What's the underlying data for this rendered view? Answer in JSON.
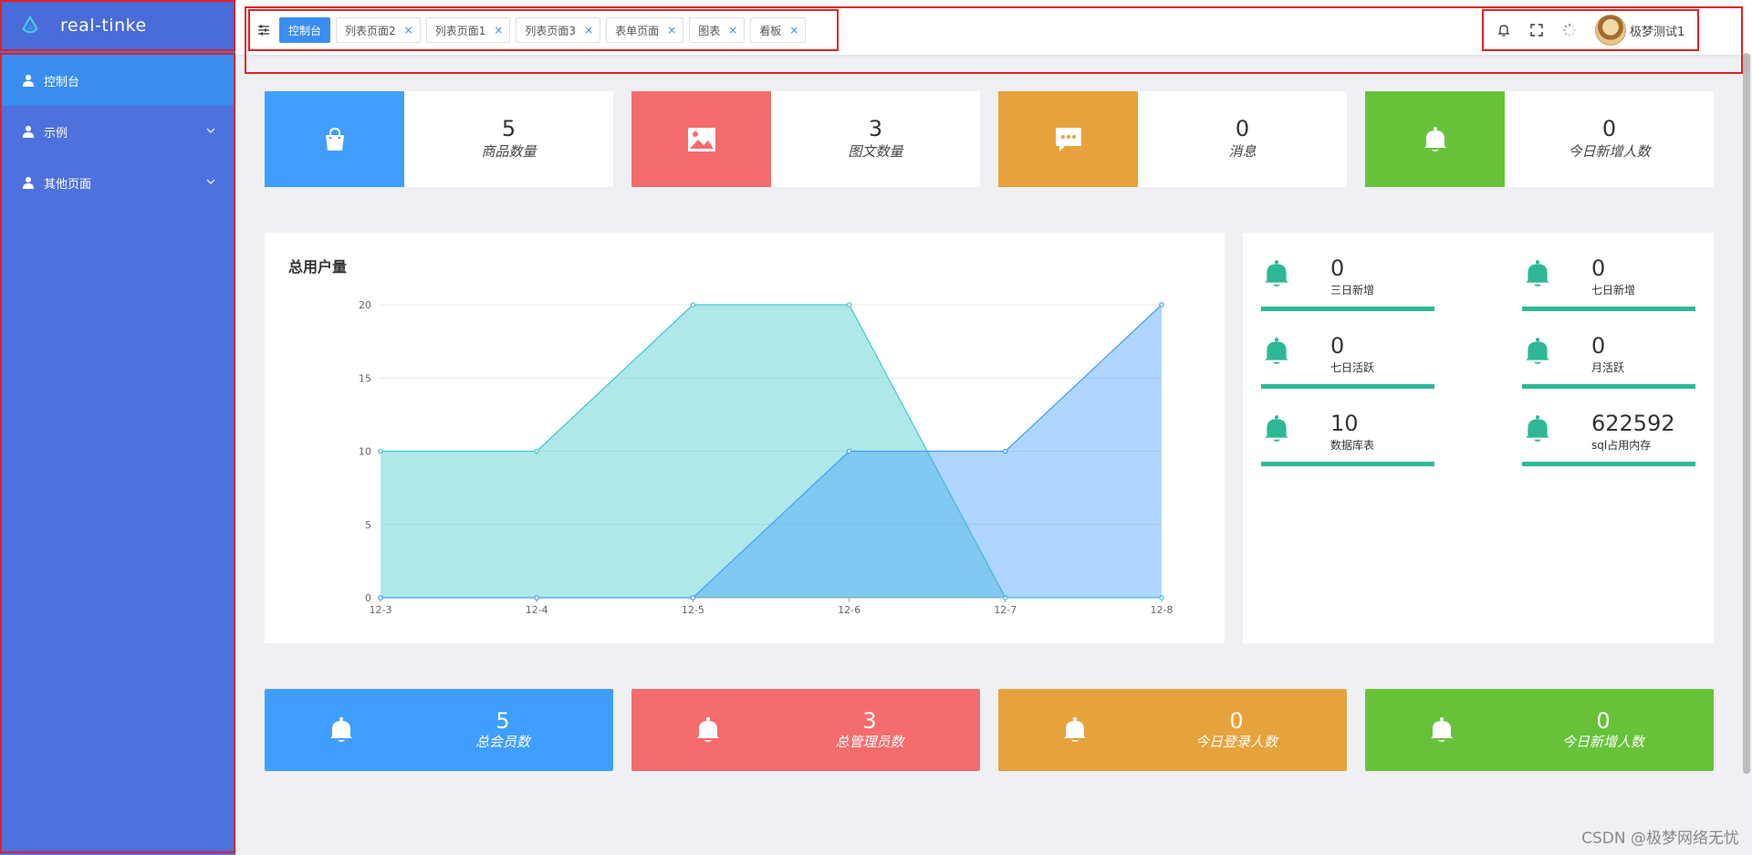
{
  "app": {
    "logo_text": "real-tinke"
  },
  "sidebar": {
    "items": [
      {
        "label": "控制台",
        "active": true
      },
      {
        "label": "示例",
        "active": false
      },
      {
        "label": "其他页面",
        "active": false
      }
    ]
  },
  "tabs": [
    {
      "label": "控制台",
      "closable": false,
      "active": true
    },
    {
      "label": "列表页面2",
      "closable": true
    },
    {
      "label": "列表页面1",
      "closable": true
    },
    {
      "label": "列表页面3",
      "closable": true
    },
    {
      "label": "表单页面",
      "closable": true
    },
    {
      "label": "图表",
      "closable": true
    },
    {
      "label": "看板",
      "closable": true
    }
  ],
  "header": {
    "username": "极梦测试1",
    "close_glyph": "×"
  },
  "stats": [
    {
      "value": "5",
      "label": "商品数量",
      "color": "#409eff",
      "icon": "bag-icon"
    },
    {
      "value": "3",
      "label": "图文数量",
      "color": "#f56c6c",
      "icon": "image-icon"
    },
    {
      "value": "0",
      "label": "消息",
      "color": "#e6a23c",
      "icon": "message-icon"
    },
    {
      "value": "0",
      "label": "今日新增人数",
      "color": "#67c23a",
      "icon": "bell-icon"
    }
  ],
  "chart_data": {
    "type": "area",
    "title": "总用户量",
    "categories": [
      "12-3",
      "12-4",
      "12-5",
      "12-6",
      "12-7",
      "12-8"
    ],
    "series": [
      {
        "values": [
          10,
          10,
          20,
          20,
          0,
          0
        ],
        "color": "#3fc9c9"
      },
      {
        "values": [
          0,
          0,
          0,
          10,
          10,
          20
        ],
        "color": "#409eff"
      }
    ],
    "ylim": [
      0,
      20
    ],
    "yticks": [
      0,
      5,
      10,
      15,
      20
    ],
    "grid": true
  },
  "metrics": [
    {
      "value": "0",
      "label": "三日新增"
    },
    {
      "value": "0",
      "label": "七日新增"
    },
    {
      "value": "0",
      "label": "七日活跃"
    },
    {
      "value": "0",
      "label": "月活跃"
    },
    {
      "value": "10",
      "label": "数据库表"
    },
    {
      "value": "622592",
      "label": "sql占用内存"
    }
  ],
  "bottom_cards": [
    {
      "value": "5",
      "label": "总会员数",
      "color": "#409eff"
    },
    {
      "value": "3",
      "label": "总管理员数",
      "color": "#f56c6c"
    },
    {
      "value": "0",
      "label": "今日登录人数",
      "color": "#e6a23c"
    },
    {
      "value": "0",
      "label": "今日新增人数",
      "color": "#67c23a"
    }
  ],
  "watermark": "CSDN @极梦网络无忧"
}
